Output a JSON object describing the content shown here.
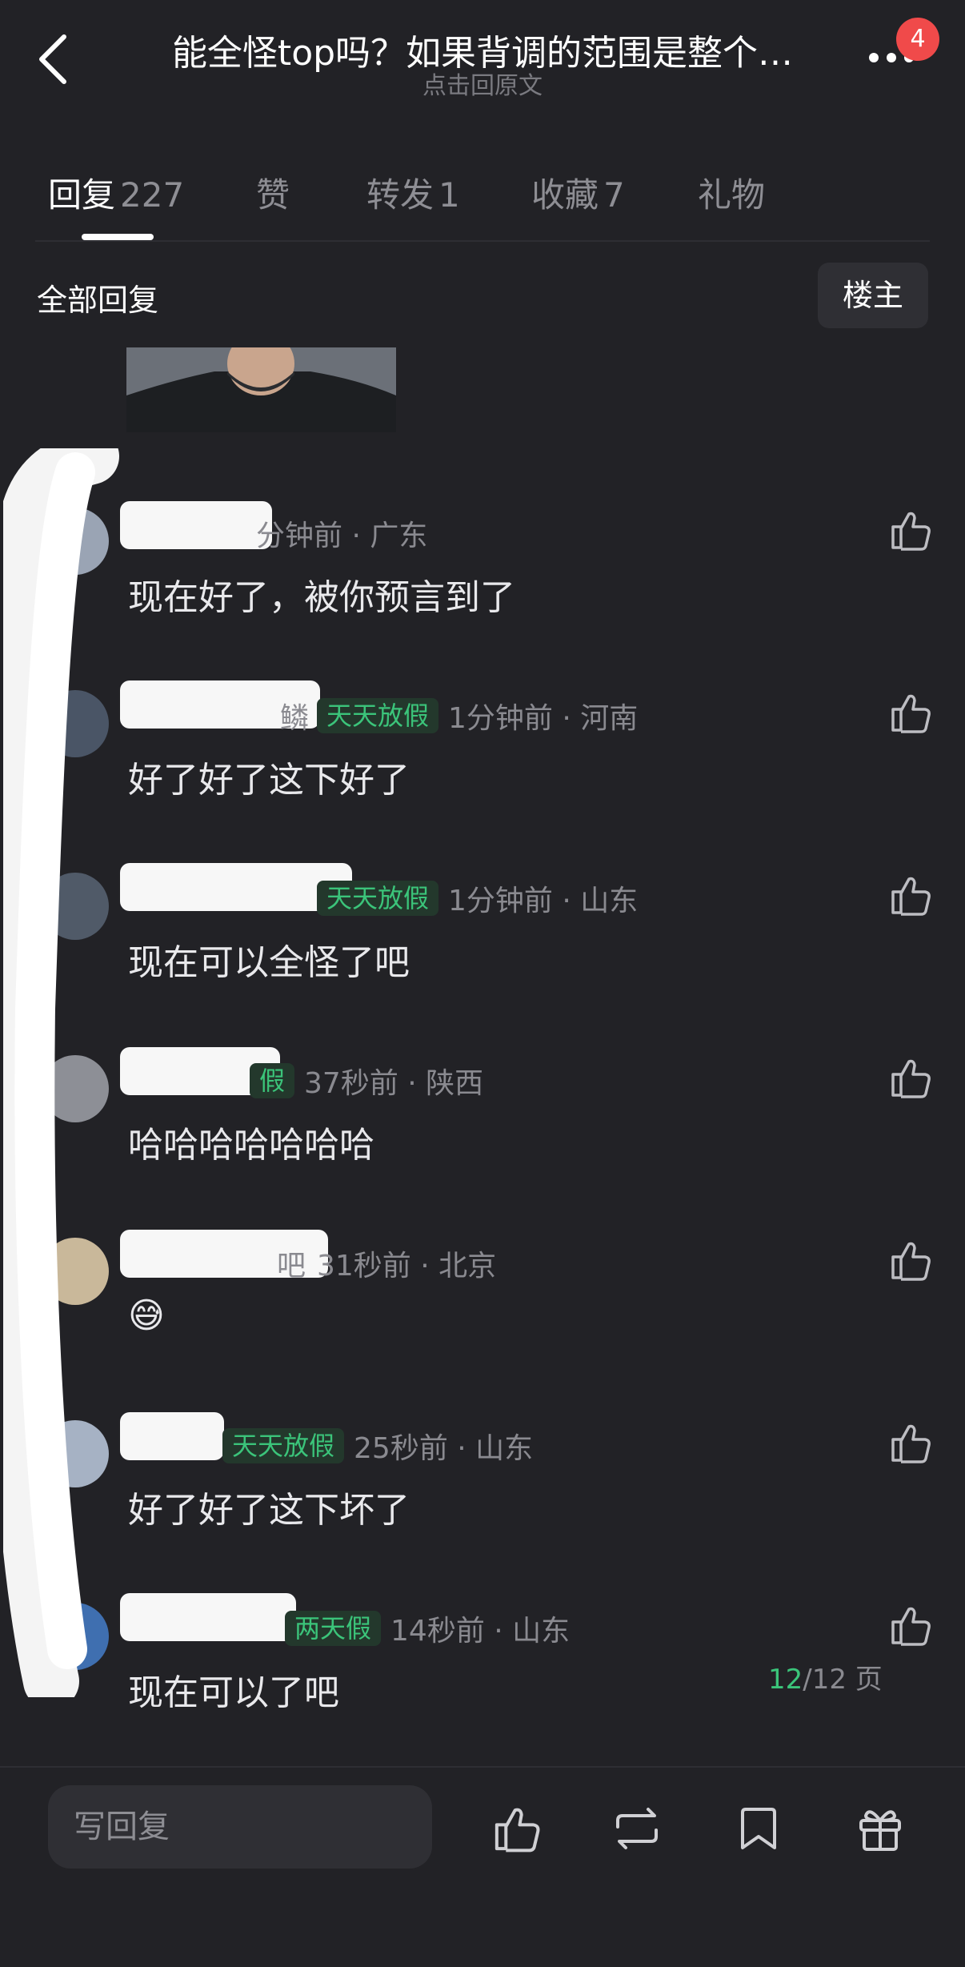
{
  "header": {
    "title": "能全怪top吗？如果背调的范围是整个…",
    "subtitle": "点击回原文",
    "badge_count": "4"
  },
  "tabs": [
    {
      "label": "回复",
      "count": "227",
      "active": true
    },
    {
      "label": "赞",
      "count": "",
      "active": false
    },
    {
      "label": "转发",
      "count": "1",
      "active": false
    },
    {
      "label": "收藏",
      "count": "7",
      "active": false
    },
    {
      "label": "礼物",
      "count": "",
      "active": false
    }
  ],
  "filter": {
    "title": "全部回复",
    "owner_button": "楼主"
  },
  "comments": [
    {
      "name_visible": "",
      "tag": "",
      "time": "分钟前 · 广东",
      "text": "现在好了，被你预言到了"
    },
    {
      "name_visible": "鳞",
      "tag": "天天放假",
      "time": "1分钟前 · 河南",
      "text": "好了好了这下好了"
    },
    {
      "name_visible": "",
      "tag": "天天放假",
      "time": "1分钟前 · 山东",
      "text": "现在可以全怪了吧"
    },
    {
      "name_visible": "",
      "tag": "假",
      "time": "37秒前 · 陕西",
      "text": "哈哈哈哈哈哈哈"
    },
    {
      "name_visible": "吧",
      "tag": "",
      "time": "31秒前 · 北京",
      "text": "😅"
    },
    {
      "name_visible": "",
      "tag": "天天放假",
      "time": "25秒前 · 山东",
      "text": "好了好了这下坏了"
    },
    {
      "name_visible": "",
      "tag": "两天假",
      "time": "14秒前 · 山东",
      "text": "现在可以了吧"
    }
  ],
  "pagination": {
    "current": "12",
    "total": "/12 页"
  },
  "bottom_bar": {
    "reply_placeholder": "写回复",
    "icons": [
      "like-icon",
      "repost-icon",
      "bookmark-icon",
      "gift-icon"
    ]
  },
  "colors": {
    "background": "#222226",
    "accent_green": "#3bc47a",
    "badge_red": "#f04a4a"
  }
}
